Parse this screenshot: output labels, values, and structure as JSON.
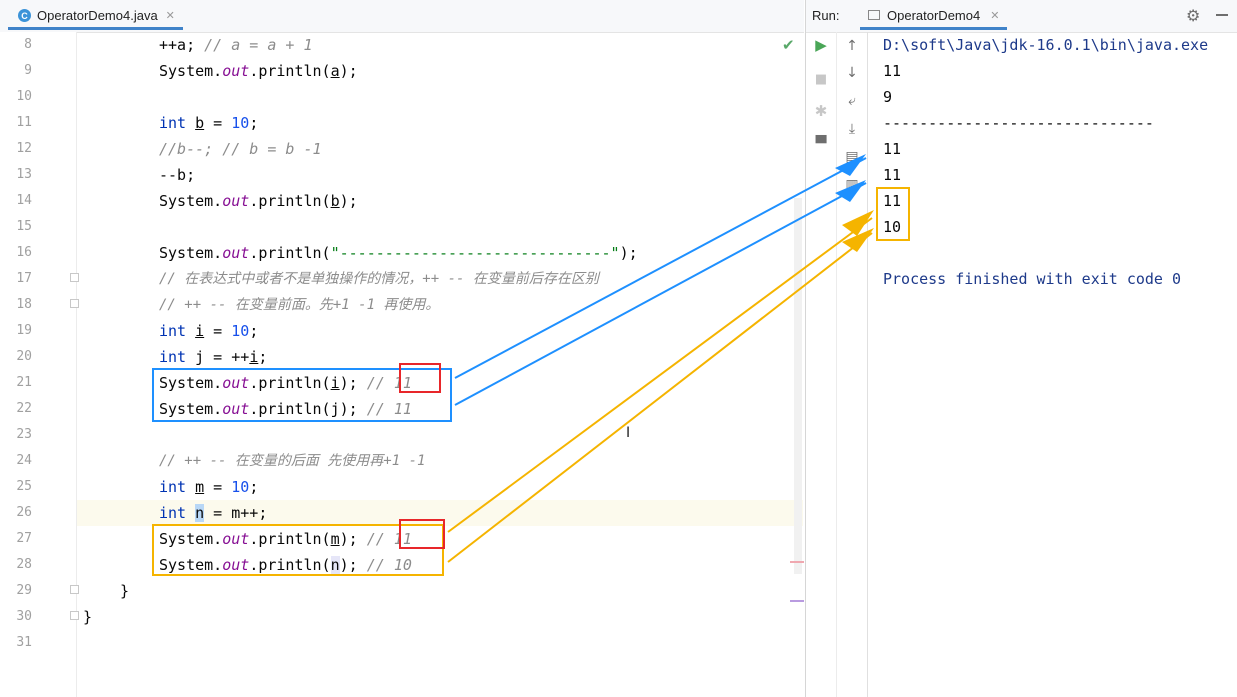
{
  "editor": {
    "tab": {
      "label": "OperatorDemo4.java",
      "icon": "java-class-icon"
    },
    "lines": [
      {
        "num": "8",
        "text": "++a; // a = a + 1"
      },
      {
        "num": "9",
        "text": "System.out.println(a);"
      },
      {
        "num": "10",
        "text": ""
      },
      {
        "num": "11",
        "text": "int b = 10;"
      },
      {
        "num": "12",
        "text": "//b--; // b = b -1"
      },
      {
        "num": "13",
        "text": "--b;"
      },
      {
        "num": "14",
        "text": "System.out.println(b);"
      },
      {
        "num": "15",
        "text": ""
      },
      {
        "num": "16",
        "text": "System.out.println(\"------------------------------\");"
      },
      {
        "num": "17",
        "text": "// 在表达式中或者不是单独操作的情况，++ -- 在变量前后存在区别"
      },
      {
        "num": "18",
        "text": "// ++ -- 在变量前面。先+1 -1 再使用。"
      },
      {
        "num": "19",
        "text": "int i = 10;"
      },
      {
        "num": "20",
        "text": "int j = ++i;"
      },
      {
        "num": "21",
        "text": "System.out.println(i); // 11"
      },
      {
        "num": "22",
        "text": "System.out.println(j); // 11"
      },
      {
        "num": "23",
        "text": ""
      },
      {
        "num": "24",
        "text": "// ++ -- 在变量的后面 先使用再+1 -1"
      },
      {
        "num": "25",
        "text": "int m = 10;"
      },
      {
        "num": "26",
        "text": "int n = m++;"
      },
      {
        "num": "27",
        "text": "System.out.println(m); // 11"
      },
      {
        "num": "28",
        "text": "System.out.println(n); // 10"
      },
      {
        "num": "29",
        "text": "}"
      },
      {
        "num": "30",
        "text": "}"
      },
      {
        "num": "31",
        "text": ""
      }
    ],
    "code": {
      "l8_pre": "++a; ",
      "l8_cmt": "// a = a + 1",
      "sys": "System.",
      "out": "out",
      "println": ".println(",
      "var_a": "a",
      "var_b": "b",
      "var_i": "i",
      "var_j": "j",
      "var_m": "m",
      "var_n": "n",
      "close": ");",
      "kw_int": "int",
      "eq10": " = ",
      "ten": "10",
      "semi": ";",
      "l12_cmt": "//b--; // b = b -1",
      "l13": "--b;",
      "dash_str": "\"------------------------------\"",
      "l17_cmt": "// 在表达式中或者不是单独操作的情况，++ -- 在变量前后存在区别",
      "l18_cmt": "// ++ -- 在变量前面。先+1 -1 再使用。",
      "l20_rhs": " = ++",
      "l24_cmt": "// ++ -- 在变量的后面 先使用再+1 -1",
      "l26_rhs": " = m++;",
      "cmt_slashes": "// ",
      "c11": "11",
      "c10": "10",
      "brace": "}"
    }
  },
  "run": {
    "label": "Run:",
    "tab_label": "OperatorDemo4",
    "output": [
      "D:\\soft\\Java\\jdk-16.0.1\\bin\\java.exe",
      "11",
      "9",
      "------------------------------",
      "11",
      "11",
      "11",
      "10",
      "",
      "Process finished with exit code 0"
    ]
  },
  "colors": {
    "blue_annotation": "#1e90ff",
    "orange_annotation": "#f5b400",
    "red_annotation": "#e8262a",
    "keyword": "#0033b3",
    "number": "#1750eb",
    "field": "#871094"
  }
}
